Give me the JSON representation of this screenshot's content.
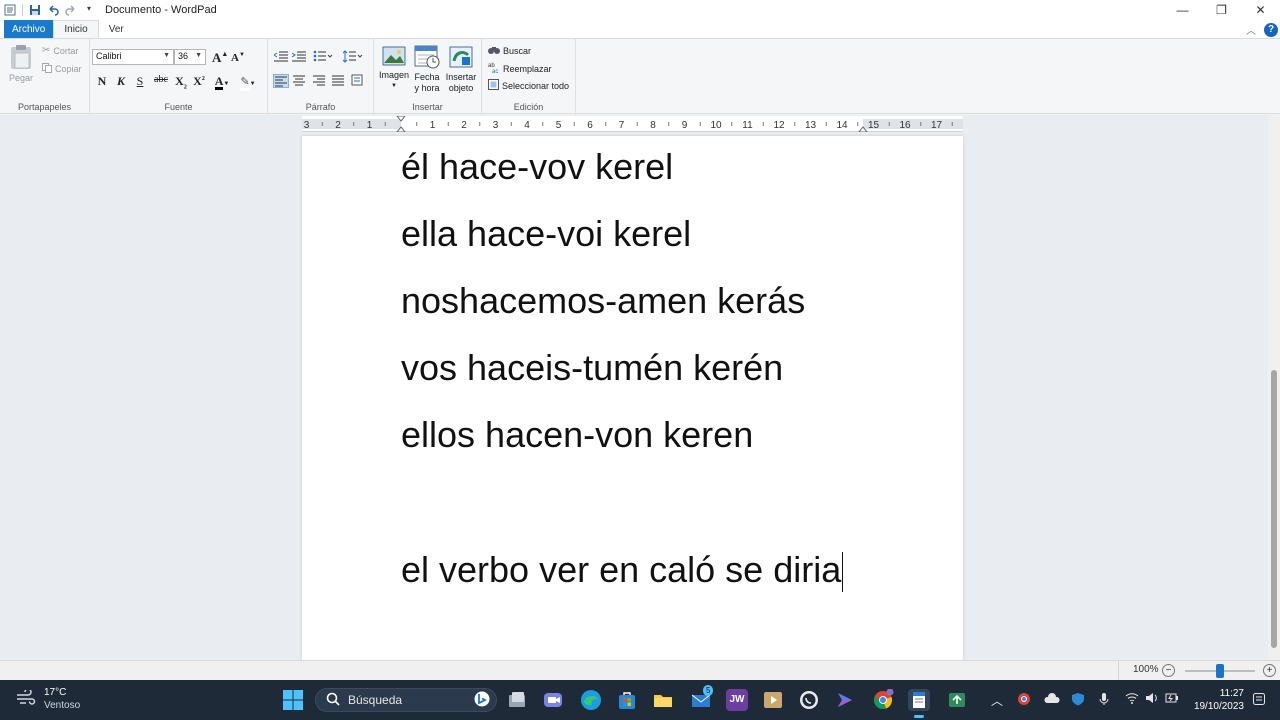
{
  "window": {
    "title": "Documento - WordPad",
    "controls": {
      "minimize": "—",
      "restore": "❐",
      "close": "✕"
    }
  },
  "tabs": {
    "file": "Archivo",
    "home": "Inicio",
    "view": "Ver",
    "help": "?"
  },
  "ribbon": {
    "clipboard": {
      "label": "Portapapeles",
      "paste": "Pegar",
      "cut": "Cortar",
      "copy": "Copiar"
    },
    "font": {
      "label": "Fuente",
      "family": "Calibri",
      "size": "36",
      "grow": "A",
      "shrink": "A",
      "bold": "N",
      "italic": "K",
      "underline": "S",
      "strike": "abc",
      "subscript": "X",
      "superscript": "X",
      "color": "A"
    },
    "paragraph": {
      "label": "Párrafo"
    },
    "insert": {
      "label": "Insertar",
      "image": "Imagen",
      "datetime_1": "Fecha",
      "datetime_2": "y hora",
      "object_1": "Insertar",
      "object_2": "objeto"
    },
    "editing": {
      "label": "Edición",
      "find": "Buscar",
      "replace": "Reemplazar",
      "select_all": "Seleccionar todo"
    }
  },
  "ruler": {
    "labels": [
      "3",
      "2",
      "1",
      "1",
      "2",
      "3",
      "4",
      "5",
      "6",
      "7",
      "8",
      "9",
      "10",
      "11",
      "12",
      "13",
      "14",
      "15",
      "16",
      "17"
    ]
  },
  "document": {
    "lines": [
      "él hace-vov kerel",
      "ella hace-voi kerel",
      "noshacemos-amen kerás",
      "vos haceis-tumén kerén",
      "ellos hacen-von keren",
      "el verbo ver en caló se diria"
    ]
  },
  "status": {
    "zoom": "100%",
    "zoom_out": "−",
    "zoom_in": "+",
    "zoom_level": 0.5
  },
  "taskbar": {
    "weather_temp": "17°C",
    "weather_desc": "Ventoso",
    "search_placeholder": "Búsqueda",
    "mail_badge": "5",
    "time": "11:27",
    "date": "19/10/2023"
  },
  "colors": {
    "accent": "#1979ca",
    "taskbar": "#1f2a38"
  }
}
